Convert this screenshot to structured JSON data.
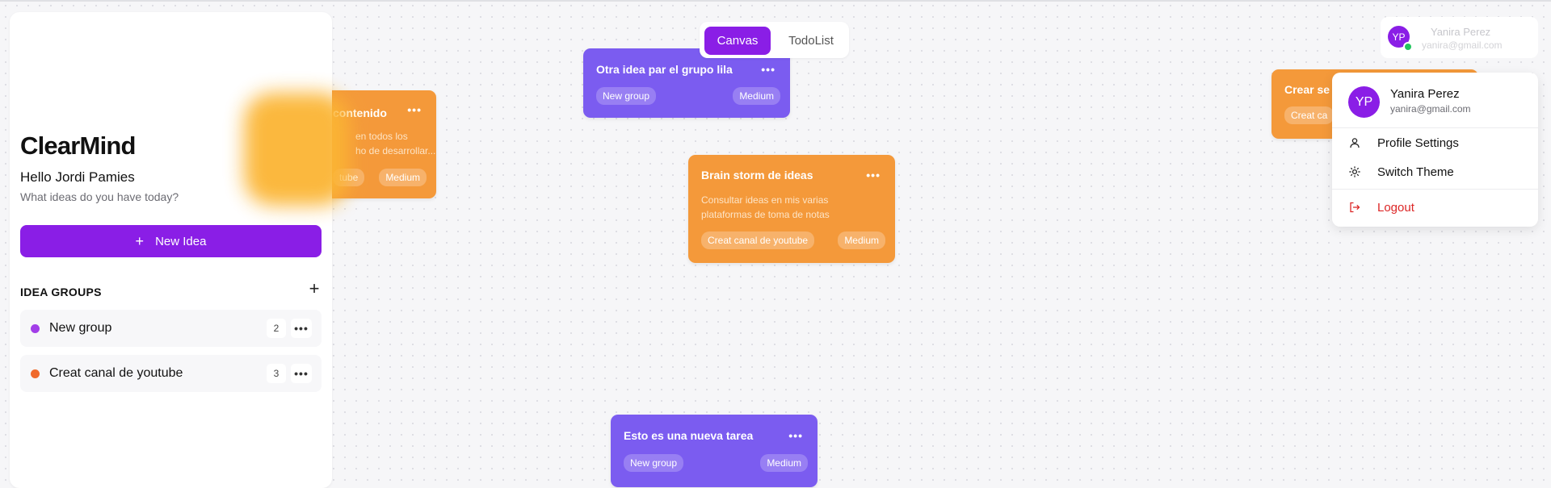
{
  "app": {
    "brand": "ClearMind",
    "greeting": "Hello Jordi Pamies",
    "subgreeting": "What ideas do you have today?",
    "new_idea_label": "New Idea"
  },
  "sidebar": {
    "groups_heading": "IDEA GROUPS",
    "groups": [
      {
        "name": "New group",
        "count": "2",
        "color": "#a23ee8"
      },
      {
        "name": "Creat canal de youtube",
        "count": "3",
        "color": "#f06a2c"
      }
    ]
  },
  "view_switch": {
    "canvas_label": "Canvas",
    "todo_label": "TodoList",
    "active": "Canvas"
  },
  "user": {
    "initials": "YP",
    "name": "Yanira Perez",
    "email": "yanira@gmail.com"
  },
  "menu": {
    "name": "Yanira Perez",
    "email": "yanira@gmail.com",
    "profile_label": "Profile Settings",
    "theme_label": "Switch Theme",
    "logout_label": "Logout"
  },
  "cards": [
    {
      "title": "contenido",
      "desc1": "en todos los",
      "desc2": "ho de desarrollar...",
      "tag_group": "tube",
      "tag_priority": "Medium",
      "color": "orange"
    },
    {
      "title": "Otra idea par el grupo lila",
      "tag_group": "New group",
      "tag_priority": "Medium",
      "color": "purple"
    },
    {
      "title": "Brain storm de ideas",
      "desc1": "Consultar ideas en mis varias",
      "desc2": "plataformas de toma de notas",
      "tag_group": "Creat canal de youtube",
      "tag_priority": "Medium",
      "color": "orange"
    },
    {
      "title": "Esto es una nueva tarea",
      "tag_group": "New group",
      "tag_priority": "Medium",
      "color": "purple"
    },
    {
      "title": "Crear se",
      "tag_group": "Creat ca",
      "color": "orange"
    }
  ],
  "colors": {
    "accent": "#8a1ee6",
    "card_orange": "#f4993a",
    "card_purple": "#7b5cf0",
    "logout": "#dc2626"
  }
}
